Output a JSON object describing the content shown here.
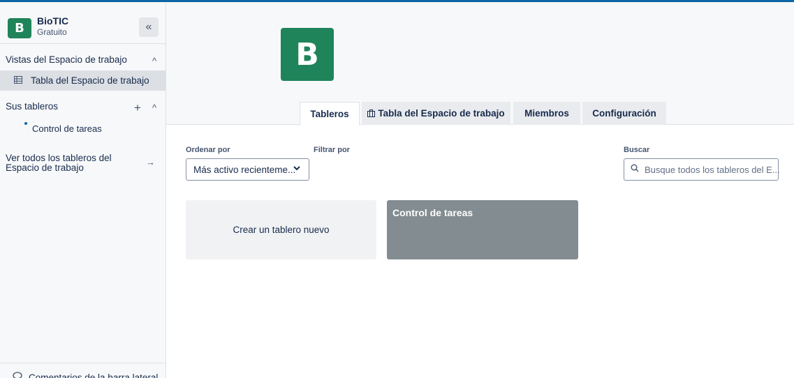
{
  "colors": {
    "brand": "#1f845a",
    "accent": "#0c66a4",
    "board_tile": "#838c91"
  },
  "workspace": {
    "initial": "B",
    "name": "BioTIC",
    "plan": "Gratuito"
  },
  "sidebar": {
    "collapse_icon": "«",
    "views_title": "Vistas del Espacio de trabajo",
    "views_chevron": "^",
    "views_item": "Tabla del Espacio de trabajo",
    "views_item_icon": "table-icon",
    "boards_title": "Sus tableros",
    "boards_plus": "+",
    "boards_chevron": "^",
    "boards": [
      {
        "label": "Control de tareas"
      }
    ],
    "view_all": "Ver todos los tableros del Espacio de trabajo",
    "view_all_arrow": "→",
    "feedback": "Comentarios de la barra lateral"
  },
  "header": {
    "logo_initial": "B"
  },
  "tabs": [
    {
      "label": "Tableros",
      "active": true
    },
    {
      "label": "Tabla del Espacio de trabajo",
      "icon": "briefcase-icon"
    },
    {
      "label": "Miembros"
    },
    {
      "label": "Configuración"
    }
  ],
  "controls": {
    "sort_label": "Ordenar por",
    "sort_value": "Más activo recienteme...",
    "filter_label": "Filtrar por",
    "search_label": "Buscar",
    "search_placeholder": "Busque todos los tableros del E..."
  },
  "boards_grid": {
    "create_label": "Crear un tablero nuevo",
    "boards": [
      {
        "title": "Control de tareas"
      }
    ]
  }
}
